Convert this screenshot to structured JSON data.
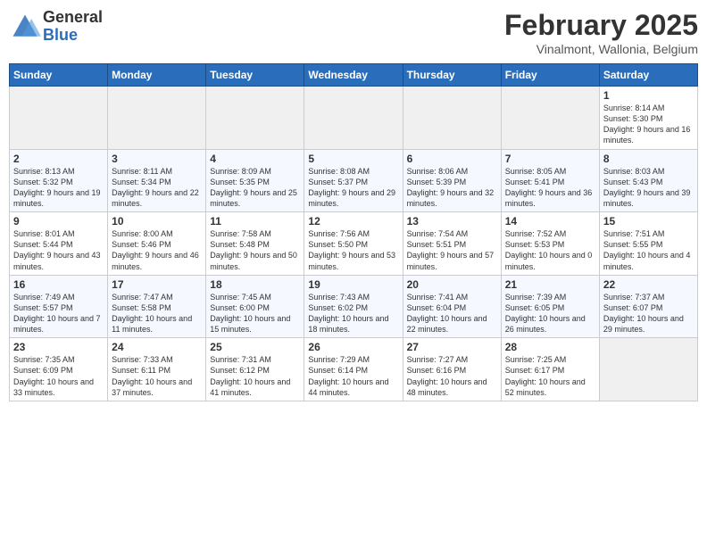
{
  "header": {
    "logo_general": "General",
    "logo_blue": "Blue",
    "title": "February 2025",
    "location": "Vinalmont, Wallonia, Belgium"
  },
  "weekdays": [
    "Sunday",
    "Monday",
    "Tuesday",
    "Wednesday",
    "Thursday",
    "Friday",
    "Saturday"
  ],
  "weeks": [
    [
      {
        "day": "",
        "info": ""
      },
      {
        "day": "",
        "info": ""
      },
      {
        "day": "",
        "info": ""
      },
      {
        "day": "",
        "info": ""
      },
      {
        "day": "",
        "info": ""
      },
      {
        "day": "",
        "info": ""
      },
      {
        "day": "1",
        "info": "Sunrise: 8:14 AM\nSunset: 5:30 PM\nDaylight: 9 hours and 16 minutes."
      }
    ],
    [
      {
        "day": "2",
        "info": "Sunrise: 8:13 AM\nSunset: 5:32 PM\nDaylight: 9 hours and 19 minutes."
      },
      {
        "day": "3",
        "info": "Sunrise: 8:11 AM\nSunset: 5:34 PM\nDaylight: 9 hours and 22 minutes."
      },
      {
        "day": "4",
        "info": "Sunrise: 8:09 AM\nSunset: 5:35 PM\nDaylight: 9 hours and 25 minutes."
      },
      {
        "day": "5",
        "info": "Sunrise: 8:08 AM\nSunset: 5:37 PM\nDaylight: 9 hours and 29 minutes."
      },
      {
        "day": "6",
        "info": "Sunrise: 8:06 AM\nSunset: 5:39 PM\nDaylight: 9 hours and 32 minutes."
      },
      {
        "day": "7",
        "info": "Sunrise: 8:05 AM\nSunset: 5:41 PM\nDaylight: 9 hours and 36 minutes."
      },
      {
        "day": "8",
        "info": "Sunrise: 8:03 AM\nSunset: 5:43 PM\nDaylight: 9 hours and 39 minutes."
      }
    ],
    [
      {
        "day": "9",
        "info": "Sunrise: 8:01 AM\nSunset: 5:44 PM\nDaylight: 9 hours and 43 minutes."
      },
      {
        "day": "10",
        "info": "Sunrise: 8:00 AM\nSunset: 5:46 PM\nDaylight: 9 hours and 46 minutes."
      },
      {
        "day": "11",
        "info": "Sunrise: 7:58 AM\nSunset: 5:48 PM\nDaylight: 9 hours and 50 minutes."
      },
      {
        "day": "12",
        "info": "Sunrise: 7:56 AM\nSunset: 5:50 PM\nDaylight: 9 hours and 53 minutes."
      },
      {
        "day": "13",
        "info": "Sunrise: 7:54 AM\nSunset: 5:51 PM\nDaylight: 9 hours and 57 minutes."
      },
      {
        "day": "14",
        "info": "Sunrise: 7:52 AM\nSunset: 5:53 PM\nDaylight: 10 hours and 0 minutes."
      },
      {
        "day": "15",
        "info": "Sunrise: 7:51 AM\nSunset: 5:55 PM\nDaylight: 10 hours and 4 minutes."
      }
    ],
    [
      {
        "day": "16",
        "info": "Sunrise: 7:49 AM\nSunset: 5:57 PM\nDaylight: 10 hours and 7 minutes."
      },
      {
        "day": "17",
        "info": "Sunrise: 7:47 AM\nSunset: 5:58 PM\nDaylight: 10 hours and 11 minutes."
      },
      {
        "day": "18",
        "info": "Sunrise: 7:45 AM\nSunset: 6:00 PM\nDaylight: 10 hours and 15 minutes."
      },
      {
        "day": "19",
        "info": "Sunrise: 7:43 AM\nSunset: 6:02 PM\nDaylight: 10 hours and 18 minutes."
      },
      {
        "day": "20",
        "info": "Sunrise: 7:41 AM\nSunset: 6:04 PM\nDaylight: 10 hours and 22 minutes."
      },
      {
        "day": "21",
        "info": "Sunrise: 7:39 AM\nSunset: 6:05 PM\nDaylight: 10 hours and 26 minutes."
      },
      {
        "day": "22",
        "info": "Sunrise: 7:37 AM\nSunset: 6:07 PM\nDaylight: 10 hours and 29 minutes."
      }
    ],
    [
      {
        "day": "23",
        "info": "Sunrise: 7:35 AM\nSunset: 6:09 PM\nDaylight: 10 hours and 33 minutes."
      },
      {
        "day": "24",
        "info": "Sunrise: 7:33 AM\nSunset: 6:11 PM\nDaylight: 10 hours and 37 minutes."
      },
      {
        "day": "25",
        "info": "Sunrise: 7:31 AM\nSunset: 6:12 PM\nDaylight: 10 hours and 41 minutes."
      },
      {
        "day": "26",
        "info": "Sunrise: 7:29 AM\nSunset: 6:14 PM\nDaylight: 10 hours and 44 minutes."
      },
      {
        "day": "27",
        "info": "Sunrise: 7:27 AM\nSunset: 6:16 PM\nDaylight: 10 hours and 48 minutes."
      },
      {
        "day": "28",
        "info": "Sunrise: 7:25 AM\nSunset: 6:17 PM\nDaylight: 10 hours and 52 minutes."
      },
      {
        "day": "",
        "info": ""
      }
    ]
  ]
}
